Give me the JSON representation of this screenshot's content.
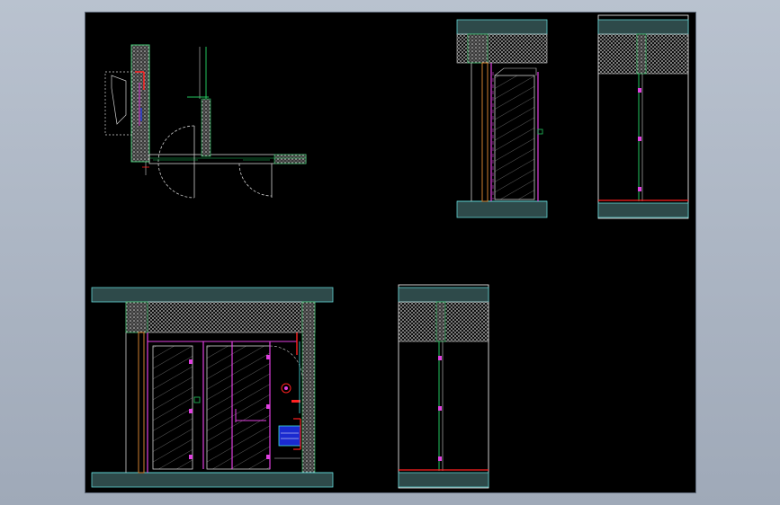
{
  "window": {
    "background": "#a9b3c2",
    "canvas_color": "#000000"
  },
  "colors": {
    "slab": "#2e4a4a",
    "slab_edge": "#5fd3d3",
    "wall": "#ffffff",
    "green": "#22c55e",
    "magenta": "#e040e0",
    "red": "#ff2020",
    "orange": "#d08030",
    "cyan": "#40e0e0",
    "blue": "#2040ff",
    "yellow": "#e0d020",
    "hatch": "#d0d0d0"
  },
  "drawing": {
    "views": [
      {
        "name": "plan-view"
      },
      {
        "name": "door-elevation-small"
      },
      {
        "name": "section-small"
      },
      {
        "name": "door-elevation-large"
      },
      {
        "name": "section-large"
      }
    ]
  }
}
